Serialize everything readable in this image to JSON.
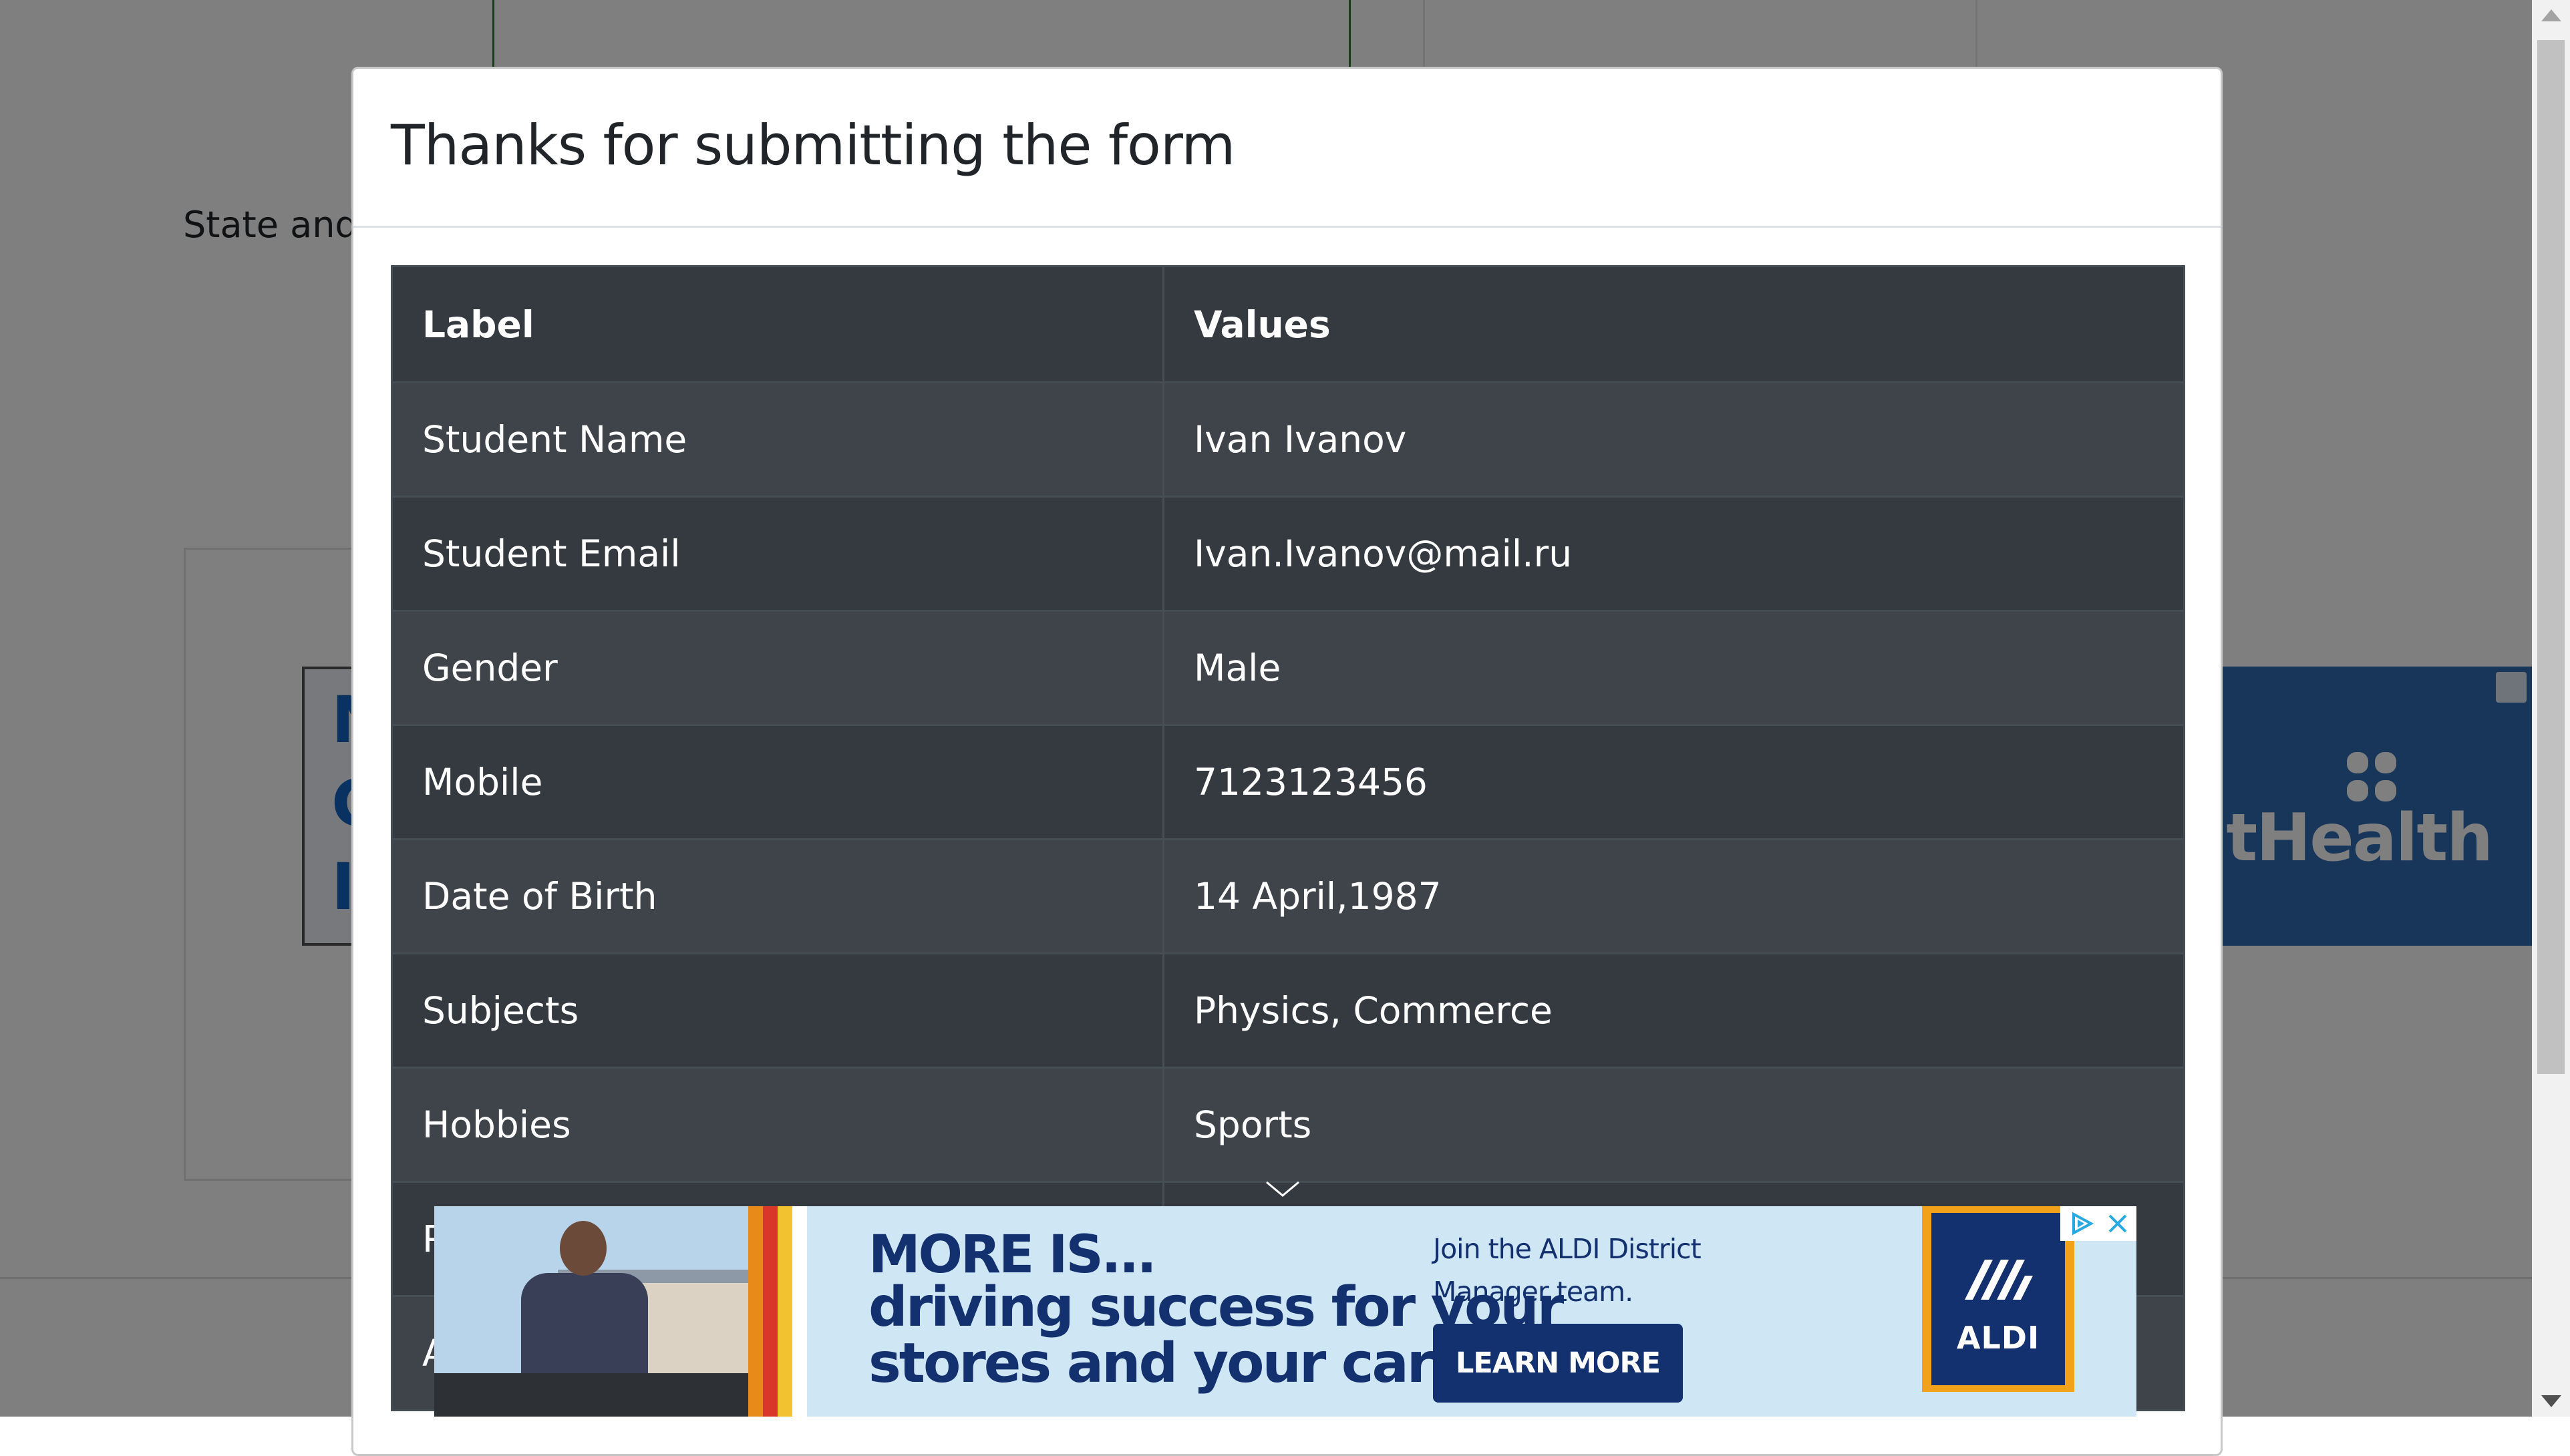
{
  "background_page": {
    "state_city_label": "State and"
  },
  "background_ads": {
    "left_ad_letters": [
      "N",
      "C",
      "I"
    ],
    "right_ad_text": "ntHealth"
  },
  "modal": {
    "title": "Thanks for submitting the form",
    "table": {
      "headers": [
        "Label",
        "Values"
      ],
      "rows": [
        {
          "label": "Student Name",
          "value": "Ivan Ivanov"
        },
        {
          "label": "Student Email",
          "value": "Ivan.Ivanov@mail.ru"
        },
        {
          "label": "Gender",
          "value": "Male"
        },
        {
          "label": "Mobile",
          "value": "7123123456"
        },
        {
          "label": "Date of Birth",
          "value": "14 April,1987"
        },
        {
          "label": "Subjects",
          "value": "Physics, Commerce"
        },
        {
          "label": "Hobbies",
          "value": "Sports"
        },
        {
          "label": "P",
          "value": ""
        },
        {
          "label": "A",
          "value": ""
        }
      ]
    }
  },
  "bottom_ad": {
    "headline_line1": "MORE IS...",
    "headline_line2": "driving success for your",
    "headline_line3": "stores and your career.",
    "subtext": "Join the ALDI District Manager team.",
    "cta_label": "LEARN MORE",
    "logo_text": "ALDI",
    "close_icon": "close-icon",
    "ad_choices_icon": "ad-choices-icon"
  },
  "colors": {
    "table_header_bg": "#343a40",
    "table_row_odd_bg": "#3e444a",
    "table_border": "#454d55",
    "overlay": "rgba(0,0,0,0.5)",
    "ad_navy": "#13306f",
    "ad_background": "#cfe6f5",
    "ad_orange": "#f2a21a"
  }
}
